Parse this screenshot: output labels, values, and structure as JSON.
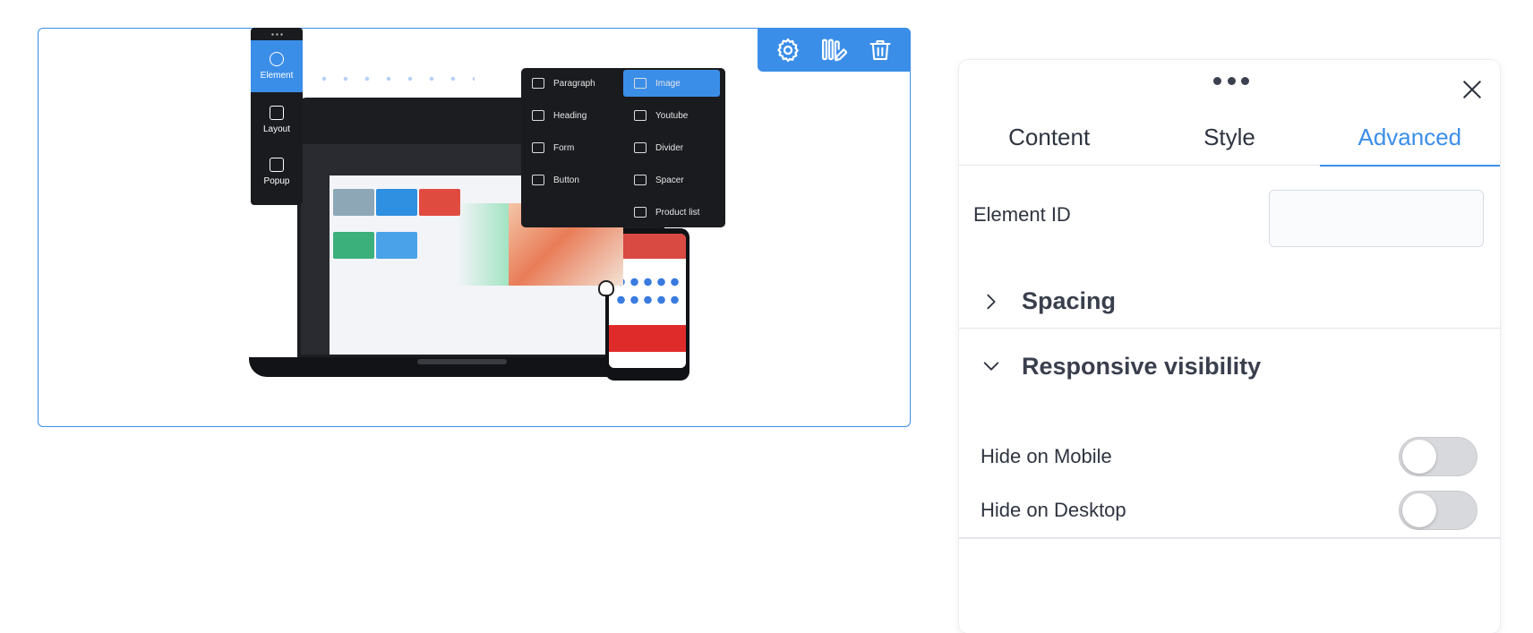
{
  "canvas": {
    "toolbar": {
      "settings_icon": "gear-icon",
      "edit_icon": "columns-edit-icon",
      "delete_icon": "trash-icon"
    },
    "illustration": {
      "left_panel": [
        "Element",
        "Layout",
        "Popup"
      ],
      "menu_items": [
        "Paragraph",
        "Image",
        "Heading",
        "Youtube",
        "Form",
        "Divider",
        "Button",
        "Spacer",
        "Product list"
      ]
    }
  },
  "panel": {
    "tabs": [
      {
        "label": "Content",
        "active": false
      },
      {
        "label": "Style",
        "active": false
      },
      {
        "label": "Advanced",
        "active": true
      }
    ],
    "element_id": {
      "label": "Element ID",
      "value": ""
    },
    "sections": {
      "spacing": {
        "title": "Spacing",
        "expanded": false
      },
      "responsive": {
        "title": "Responsive visibility",
        "expanded": true
      }
    },
    "toggles": {
      "hide_mobile": {
        "label": "Hide on Mobile",
        "on": false
      },
      "hide_desktop": {
        "label": "Hide on Desktop",
        "on": false
      }
    }
  },
  "colors": {
    "accent": "#3b8ee8",
    "toggle_off": "#d8d9dc"
  }
}
